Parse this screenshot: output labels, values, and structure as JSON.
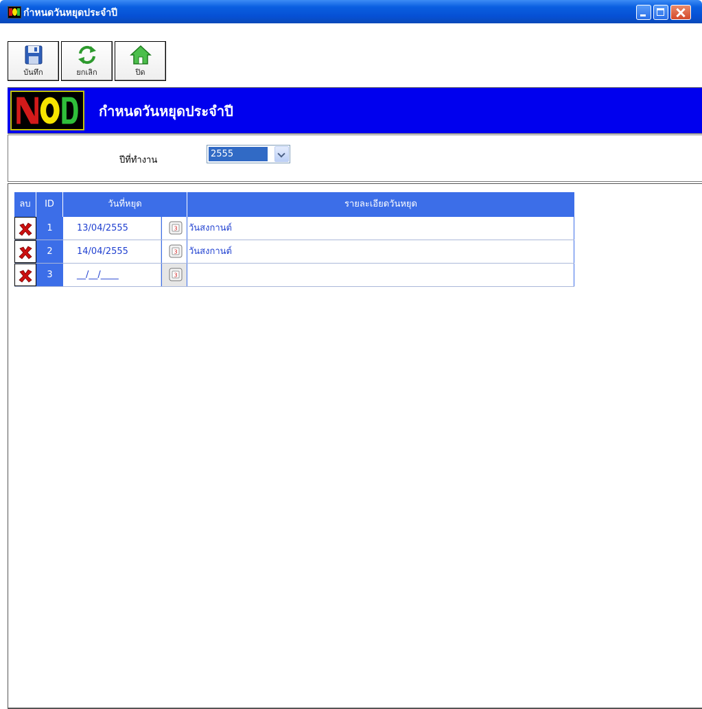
{
  "window": {
    "title": "กำหนดวันหยุดประจำปี"
  },
  "toolbar": {
    "save_label": "บันทึก",
    "cancel_label": "ยกเลิก",
    "close_label": "ปิด"
  },
  "banner": {
    "title": "กำหนดวันหยุดประจำปี"
  },
  "year": {
    "label": "ปีที่ทำงาน",
    "selected": "2555"
  },
  "grid": {
    "columns": [
      "ลบ",
      "ID",
      "วันที่หยุด",
      "รายละเอียดวันหยุด"
    ],
    "rows": [
      {
        "id": "1",
        "date": "13/04/2555",
        "detail": "วันสงกานต์"
      },
      {
        "id": "2",
        "date": "14/04/2555",
        "detail": "วันสงกานต์"
      },
      {
        "id": "3",
        "date": "__/__/____",
        "detail": ""
      }
    ]
  },
  "colors": {
    "titlebar": "#0650d4",
    "banner": "#0000ee",
    "grid_header": "#3c6ee8",
    "selection": "#316ac5"
  }
}
